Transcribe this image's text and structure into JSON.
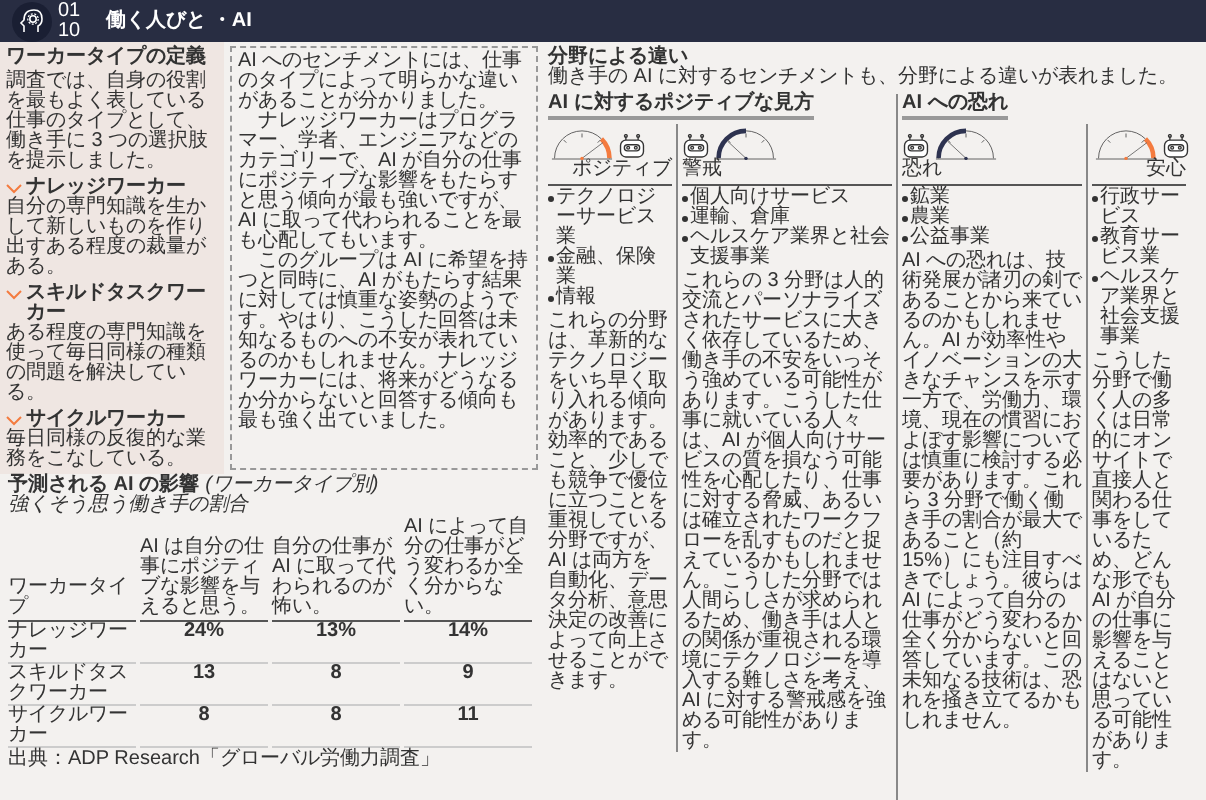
{
  "header": {
    "title": "働く人びと ・AI",
    "logo_labels": [
      "01",
      "10"
    ]
  },
  "definitions": {
    "title": "ワーカータイプの定義",
    "intro": "調査では、自身の役割を最もよく表している仕事のタイプとして、働き手に 3 つの選択肢を提示しました。",
    "types": [
      {
        "name": "ナレッジワーカー",
        "description": "自分の専門知識を生かして新しいものを作り出すある程度の裁量がある。"
      },
      {
        "name": "スキルドタスクワーカー",
        "description": "ある程度の専門知識を使って毎日同様の種類の問題を解決している。"
      },
      {
        "name": "サイクルワーカー",
        "description": "毎日同様の反復的な業務をこなしている。"
      }
    ]
  },
  "callout": {
    "paragraphs": [
      "AI へのセンチメントには、仕事のタイプによって明らかな違いがあることが分かりました。",
      "ナレッジワーカーはプログラマー、学者、エンジニアなどのカテゴリーで、AI が自分の仕事にポジティブな影響をもたらすと思う傾向が最も強いですが、AI に取って代わられることを最も心配してもいます。",
      "このグループは AI に希望を持つと同時に、AI がもたらす結果に対しては慎重な姿勢のようです。やはり、こうした回答は未知なるものへの不安が表れているのかもしれません。ナレッジワーカーには、将来がどうなるか分からないと回答する傾向も最も強く出ていました。"
    ]
  },
  "table": {
    "title": "予測される AI の影響",
    "title_note": "(ワーカータイプ別)",
    "subtitle": "強くそう思う働き手の割合",
    "columns": [
      "ワーカータイプ",
      "AI は自分の仕事にポジティブな影響を与えると思う。",
      "自分の仕事が AI に取って代わられるのが怖い。",
      "AI によって自分の仕事がどう変わるか全く分からない。"
    ],
    "rows": [
      {
        "cells": [
          "ナレッジワーカー",
          "24%",
          "13%",
          "14%"
        ]
      },
      {
        "cells": [
          "スキルドタスクワーカー",
          "13",
          "8",
          "9"
        ]
      },
      {
        "cells": [
          "サイクルワーカー",
          "8",
          "8",
          "11"
        ]
      }
    ],
    "source": "出典：ADP Research「グローバル労働力調査」"
  },
  "sectors": {
    "title": "分野による違い",
    "subtitle": "働き手の AI に対するセンチメントも、分野による違いが表れました。",
    "groups": [
      {
        "heading": "AI に対するポジティブな見方",
        "columns": [
          {
            "gauge": {
              "label": "ポジティブ",
              "color": "#f47b3f",
              "kind": "robot-right"
            },
            "bullets": [
              "テクノロジーサービス業",
              "金融、保険業",
              "情報"
            ],
            "text": "これらの分野は、革新的なテクノロジーをいち早く取り入れる傾向があります。効率的であること、少しでも競争で優位に立つことを重視している分野ですが、AI は両方を自動化、データ分析、意思決定の改善によって向上させることができます。"
          },
          {
            "gauge": {
              "label": "警戒",
              "color": "#2e3350",
              "kind": "robot-left"
            },
            "bullets": [
              "個人向けサービス",
              "運輸、倉庫",
              "ヘルスケア業界と社会支援事業"
            ],
            "text": "これらの 3 分野は人的交流とパーソナライズされたサービスに大きく依存しているため、働き手の不安をいっそう強めている可能性があります。こうした仕事に就いている人々は、AI が個人向けサービスの質を損なう可能性を心配したり、仕事に対する脅威、あるいは確立されたワークフローを乱すものだと捉えているかもしれません。こうした分野では人間らしさが求められるため、働き手は人との関係が重視される環境にテクノロジーを導入する難しさを考え、AI に対する警戒感を強める可能性があります。"
          }
        ]
      },
      {
        "heading": "AI への恐れ",
        "columns": [
          {
            "gauge": {
              "label": "恐れ",
              "color": "#2e3350",
              "kind": "robot-left"
            },
            "bullets": [
              "鉱業",
              "農業",
              "公益事業"
            ],
            "text": "AI への恐れは、技術発展が諸刃の剣であることから来ているのかもしれません。AI が効率性やイノベーションの大きなチャンスを示す一方で、労働力、環境、現在の慣習におよぼす影響については慎重に検討する必要があります。これら 3 分野で働く働き手の割合が最大であること（約 15%）にも注目すべきでしょう。彼らは AI によって自分の仕事がどう変わるか全く分からないと回答しています。この未知なる技術は、恐れを掻き立てるかもしれません。"
          },
          {
            "gauge": {
              "label": "安心",
              "color": "#f47b3f",
              "kind": "robot-right"
            },
            "bullets": [
              "行政サービス",
              "教育サービス業",
              "ヘルスケア業界と社会支援事業"
            ],
            "text": "こうした分野で働く人の多くは日常的にオンサイトで直接人と関わる仕事をしているため、どんな形でも AI が自分の仕事に影響を与えることはないと思っている可能性があります。"
          }
        ]
      }
    ]
  }
}
